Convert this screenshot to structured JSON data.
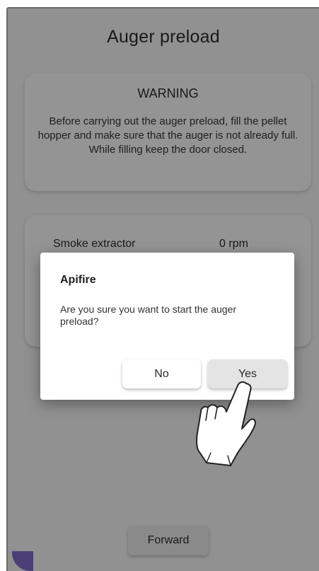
{
  "page": {
    "title": "Auger preload"
  },
  "warning": {
    "title": "WARNING",
    "text": "Before carrying out the auger preload, fill the pellet hopper and make sure that the auger is not already full. While filling keep the door closed."
  },
  "status": {
    "rows": [
      {
        "label": "Smoke extractor",
        "value": "0 rpm"
      }
    ]
  },
  "footer": {
    "forward_label": "Forward"
  },
  "dialog": {
    "title": "Apifire",
    "message": "Are you sure you want to start the auger preload?",
    "no_label": "No",
    "yes_label": "Yes"
  },
  "icons": {
    "pointer": "hand-pointer-icon"
  }
}
